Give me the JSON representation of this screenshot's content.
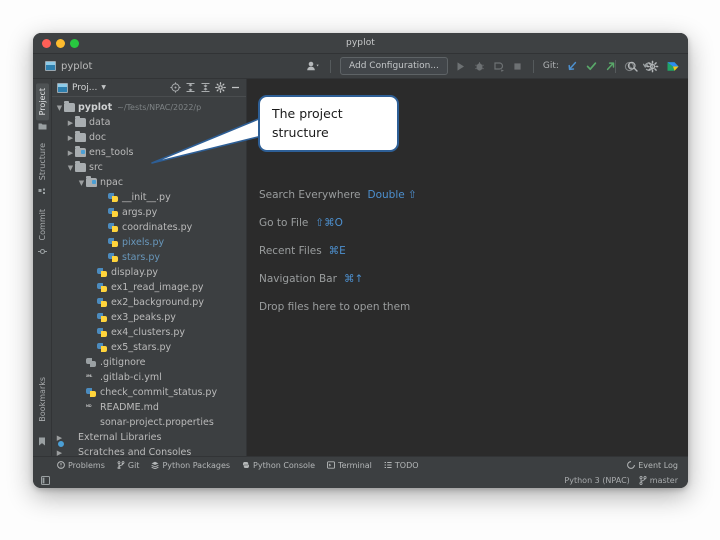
{
  "window": {
    "title": "pyplot",
    "nav_project": "pyplot"
  },
  "toolbar": {
    "run_config_icon": "run-configuration-icon",
    "add_configuration_label": "Add Configuration...",
    "run_label": "run-icon",
    "debug_label": "debug-icon",
    "profile_label": "profile-icon",
    "stop_label": "stop-icon",
    "git_label": "Git:",
    "git_update": "update-project-icon",
    "git_commit": "commit-icon",
    "git_push": "push-icon",
    "git_history": "history-icon",
    "git_rollback": "rollback-icon",
    "search": "search-icon",
    "settings": "settings-icon",
    "datalore": "datalore-icon"
  },
  "rail": {
    "tabs": [
      {
        "label": "Project",
        "icon": "project-icon",
        "active": true
      },
      {
        "label": "Structure",
        "icon": "structure-icon",
        "active": false
      },
      {
        "label": "Commit",
        "icon": "commit-icon",
        "active": false
      },
      {
        "label": "Bookmarks",
        "icon": "bookmarks-icon",
        "active": false
      }
    ]
  },
  "project_panel": {
    "title": "Proj...",
    "actions": [
      "select-opened-file-icon",
      "expand-all-icon",
      "collapse-all-icon",
      "settings-icon",
      "hide-icon"
    ],
    "tree": [
      {
        "label": "pyplot",
        "path": "~/Tests/NPAC/2022/p",
        "icon": "folder",
        "indent": 0,
        "arrow": "down",
        "bold": true
      },
      {
        "label": "data",
        "icon": "folder",
        "indent": 1,
        "arrow": "right"
      },
      {
        "label": "doc",
        "icon": "folder",
        "indent": 1,
        "arrow": "right"
      },
      {
        "label": "ens_tools",
        "icon": "folder-source",
        "indent": 1,
        "arrow": "right"
      },
      {
        "label": "src",
        "icon": "folder",
        "indent": 1,
        "arrow": "down"
      },
      {
        "label": "npac",
        "icon": "folder-source",
        "indent": 2,
        "arrow": "down"
      },
      {
        "label": "__init__.py",
        "icon": "python",
        "indent": 4,
        "arrow": "none"
      },
      {
        "label": "args.py",
        "icon": "python",
        "indent": 4,
        "arrow": "none"
      },
      {
        "label": "coordinates.py",
        "icon": "python",
        "indent": 4,
        "arrow": "none"
      },
      {
        "label": "pixels.py",
        "icon": "python",
        "indent": 4,
        "arrow": "none",
        "color": "blue"
      },
      {
        "label": "stars.py",
        "icon": "python",
        "indent": 4,
        "arrow": "none",
        "color": "blue"
      },
      {
        "label": "display.py",
        "icon": "python",
        "indent": 3,
        "arrow": "none"
      },
      {
        "label": "ex1_read_image.py",
        "icon": "python",
        "indent": 3,
        "arrow": "none"
      },
      {
        "label": "ex2_background.py",
        "icon": "python",
        "indent": 3,
        "arrow": "none"
      },
      {
        "label": "ex3_peaks.py",
        "icon": "python",
        "indent": 3,
        "arrow": "none"
      },
      {
        "label": "ex4_clusters.py",
        "icon": "python",
        "indent": 3,
        "arrow": "none"
      },
      {
        "label": "ex5_stars.py",
        "icon": "python",
        "indent": 3,
        "arrow": "none"
      },
      {
        "label": ".gitignore",
        "icon": "gitignore",
        "indent": 2,
        "arrow": "none"
      },
      {
        "label": ".gitlab-ci.yml",
        "icon": "yml",
        "indent": 2,
        "arrow": "none"
      },
      {
        "label": "check_commit_status.py",
        "icon": "python",
        "indent": 2,
        "arrow": "none"
      },
      {
        "label": "README.md",
        "icon": "md",
        "indent": 2,
        "arrow": "none"
      },
      {
        "label": "sonar-project.properties",
        "icon": "properties",
        "indent": 2,
        "arrow": "none"
      },
      {
        "label": "External Libraries",
        "icon": "library",
        "indent": 0,
        "arrow": "right"
      },
      {
        "label": "Scratches and Consoles",
        "icon": "scratch",
        "indent": 0,
        "arrow": "right"
      }
    ]
  },
  "editor": {
    "shortcuts": [
      {
        "name": "Search Everywhere",
        "keys": "Double ⇧"
      },
      {
        "name": "Go to File",
        "keys": "⇧⌘O"
      },
      {
        "name": "Recent Files",
        "keys": "⌘E"
      },
      {
        "name": "Navigation Bar",
        "keys": "⌘↑"
      }
    ],
    "drop_hint": "Drop files here to open them"
  },
  "bottom_tabs": [
    {
      "label": "Problems",
      "icon": "problems-icon"
    },
    {
      "label": "Git",
      "icon": "git-branch-icon"
    },
    {
      "label": "Python Packages",
      "icon": "packages-icon"
    },
    {
      "label": "Python Console",
      "icon": "python-console-icon"
    },
    {
      "label": "Terminal",
      "icon": "terminal-icon"
    },
    {
      "label": "TODO",
      "icon": "todo-icon"
    }
  ],
  "event_log": {
    "label": "Event Log",
    "icon": "event-log-icon"
  },
  "statusbar": {
    "interpreter": "Python 3 (NPAC)",
    "branch": "master",
    "branch_icon": "git-branch-icon",
    "layout_icon": "tool-layout-icon"
  },
  "callout": {
    "line1": "The project",
    "line2": "structure",
    "border_color": "#2e5f96",
    "background": "#ffffff"
  },
  "colors": {
    "window_chrome": "#3c3f41",
    "editor_background": "#2b2b2b",
    "accent_blue": "#4d90cf",
    "link_blue": "#6897bb"
  }
}
